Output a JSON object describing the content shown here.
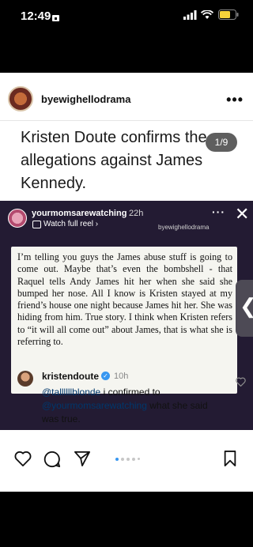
{
  "status_bar": {
    "time": "12:49"
  },
  "post": {
    "username": "byewighellodrama",
    "headline": "Kristen Doute confirms the allegations against James Kennedy.",
    "page_counter": "1/9"
  },
  "story": {
    "username": "yourmomsarewatching",
    "time": "22h",
    "reel_link": "Watch full reel ›",
    "watermark": "byewighellodrama",
    "quote": "I’m telling you guys the James abuse stuff is going to come out. Maybe that’s even the bombshell - that Raquel tells Andy James hit her when she said she bumped her nose. All I know is Kristen stayed at my friend’s house one night because James hit her. She was hiding from him. True story. I think when Kristen refers to “it will all come out” about James, that is what she is referring to."
  },
  "comment": {
    "username": "kristendoute",
    "time": "10h",
    "mention1": "@tallllllblonde",
    "text1": " i confirmed to ",
    "mention2": "@yourmomsarewatching",
    "text2": " what she said was true."
  },
  "icons": [
    "more-icon",
    "heart-icon",
    "comment-icon",
    "share-icon",
    "bookmark-icon",
    "close-icon",
    "chevron-left-icon"
  ],
  "carousel": {
    "dots": 5,
    "active": 1
  }
}
